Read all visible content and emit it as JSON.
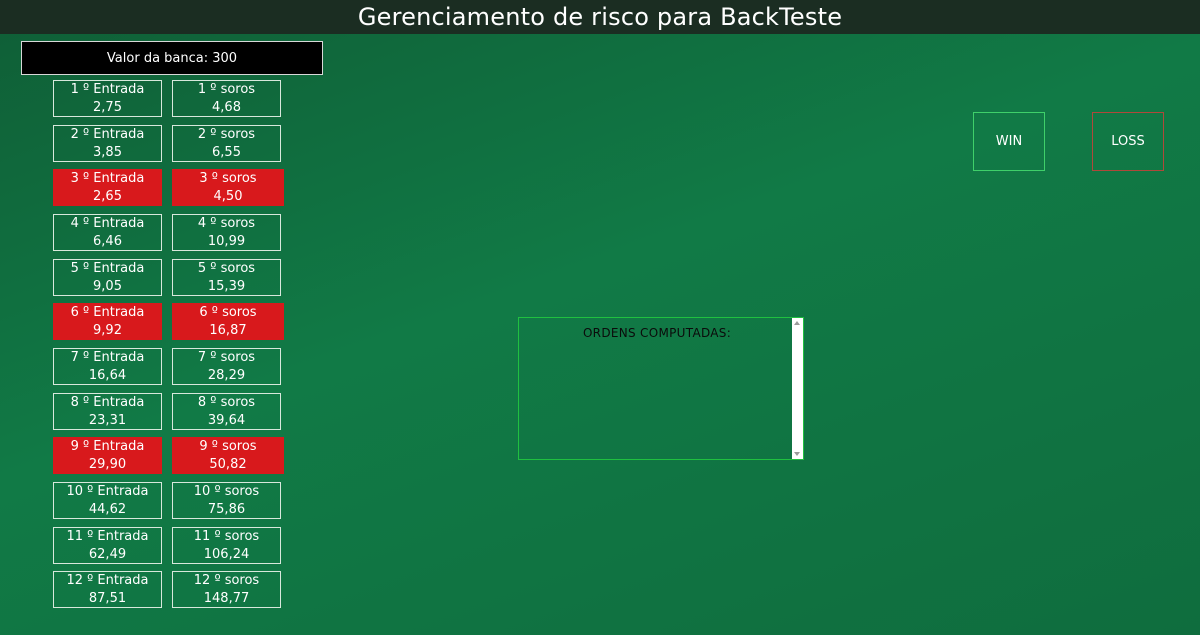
{
  "header": {
    "title": "Gerenciamento de risco para BackTeste"
  },
  "bank": {
    "label": "Valor da banca: 300"
  },
  "colors": {
    "highlight": "#d8191c",
    "background": "#117a46",
    "header": "#1b2d22",
    "win_border": "#3fd06a",
    "loss_border": "#b0483a"
  },
  "entries": [
    {
      "label": "1 º Entrada",
      "value": "2,75",
      "highlight": false
    },
    {
      "label": "2 º Entrada",
      "value": "3,85",
      "highlight": false
    },
    {
      "label": "3 º Entrada",
      "value": "2,65",
      "highlight": true
    },
    {
      "label": "4 º Entrada",
      "value": "6,46",
      "highlight": false
    },
    {
      "label": "5 º Entrada",
      "value": "9,05",
      "highlight": false
    },
    {
      "label": "6 º Entrada",
      "value": "9,92",
      "highlight": true
    },
    {
      "label": "7 º Entrada",
      "value": "16,64",
      "highlight": false
    },
    {
      "label": "8 º Entrada",
      "value": "23,31",
      "highlight": false
    },
    {
      "label": "9 º Entrada",
      "value": "29,90",
      "highlight": true
    },
    {
      "label": "10 º Entrada",
      "value": "44,62",
      "highlight": false
    },
    {
      "label": "11 º Entrada",
      "value": "62,49",
      "highlight": false
    },
    {
      "label": "12 º Entrada",
      "value": "87,51",
      "highlight": false
    }
  ],
  "soros": [
    {
      "label": "1 º soros",
      "value": "4,68",
      "highlight": false
    },
    {
      "label": "2 º soros",
      "value": "6,55",
      "highlight": false
    },
    {
      "label": "3 º soros",
      "value": "4,50",
      "highlight": true
    },
    {
      "label": "4 º soros",
      "value": "10,99",
      "highlight": false
    },
    {
      "label": "5 º soros",
      "value": "15,39",
      "highlight": false
    },
    {
      "label": "6 º soros",
      "value": "16,87",
      "highlight": true
    },
    {
      "label": "7 º soros",
      "value": "28,29",
      "highlight": false
    },
    {
      "label": "8 º soros",
      "value": "39,64",
      "highlight": false
    },
    {
      "label": "9 º soros",
      "value": "50,82",
      "highlight": true
    },
    {
      "label": "10 º soros",
      "value": "75,86",
      "highlight": false
    },
    {
      "label": "11 º soros",
      "value": "106,24",
      "highlight": false
    },
    {
      "label": "12 º soros",
      "value": "148,77",
      "highlight": false
    }
  ],
  "buttons": {
    "win": "WIN",
    "loss": "LOSS"
  },
  "orders": {
    "title": "ORDENS COMPUTADAS:",
    "content": ""
  }
}
